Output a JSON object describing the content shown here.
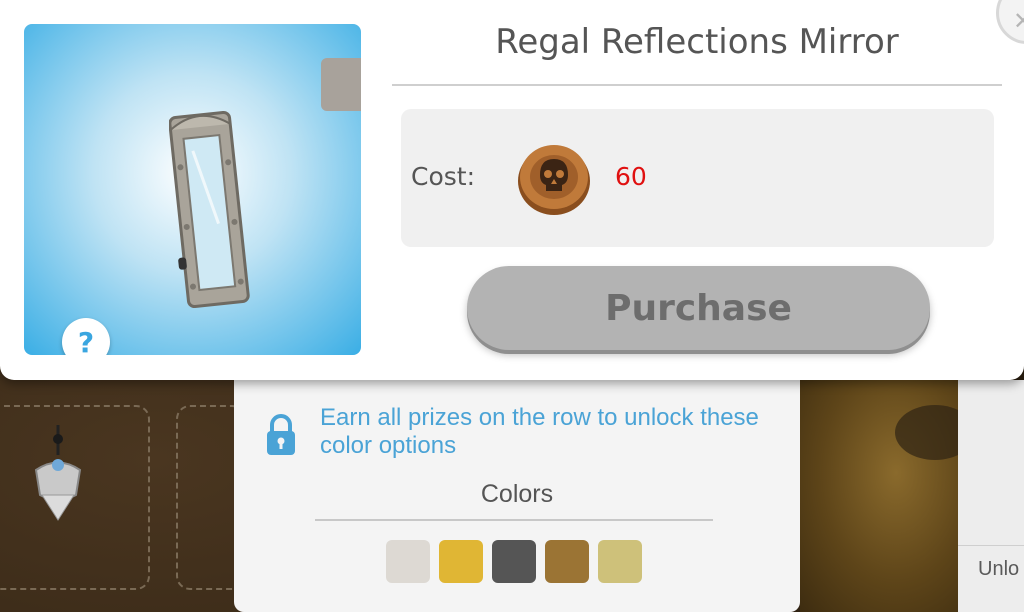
{
  "item": {
    "title": "Regal Reflections Mirror",
    "cost_label": "Cost:",
    "cost_value": "60",
    "cost_icon": "skull-coin-icon",
    "purchase_label": "Purchase",
    "help_label": "?"
  },
  "lock_message": "Earn all prizes on the row to unlock these color options",
  "colors": {
    "title": "Colors",
    "swatches": [
      "#ddd9d3",
      "#e0b634",
      "#555555",
      "#9b7434",
      "#cec17a"
    ]
  },
  "side_panel": {
    "label": "Unlo"
  }
}
